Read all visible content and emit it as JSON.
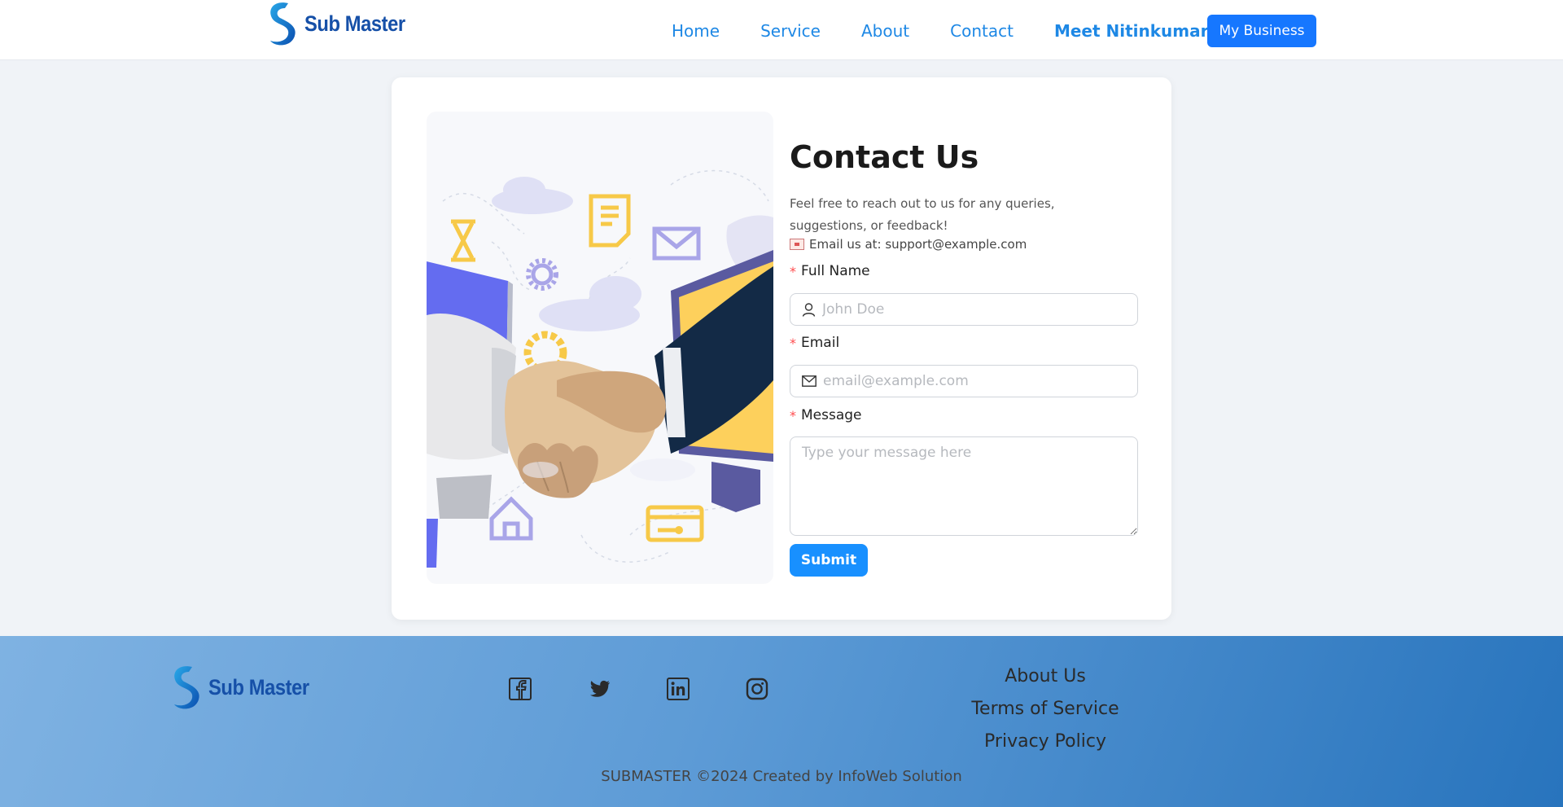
{
  "header": {
    "brand": "Sub Master",
    "nav": [
      "Home",
      "Service",
      "About",
      "Contact",
      "Meet Nitinkumar"
    ],
    "cta": "My Business"
  },
  "contact": {
    "title": "Contact Us",
    "description": "Feel free to reach out to us for any queries, suggestions, or feedback!",
    "email_line": "Email us at: support@example.com",
    "fields": {
      "name": {
        "label": "Full Name",
        "placeholder": "John Doe",
        "value": ""
      },
      "email": {
        "label": "Email",
        "placeholder": "email@example.com",
        "value": ""
      },
      "message": {
        "label": "Message",
        "placeholder": "Type your message here",
        "value": ""
      }
    },
    "submit": "Submit"
  },
  "footer": {
    "brand": "Sub Master",
    "social": [
      "facebook-icon",
      "twitter-icon",
      "linkedin-icon",
      "instagram-icon"
    ],
    "links": [
      "About Us",
      "Terms of Service",
      "Privacy Policy"
    ],
    "copyright": "SUBMASTER ©2024 Created by InfoWeb Solution"
  },
  "colors": {
    "accent": "#1677ff",
    "nav": "#1e88e5",
    "brand": "#1650a8",
    "footer_start": "#7fb2e2",
    "footer_end": "#2874bd"
  }
}
